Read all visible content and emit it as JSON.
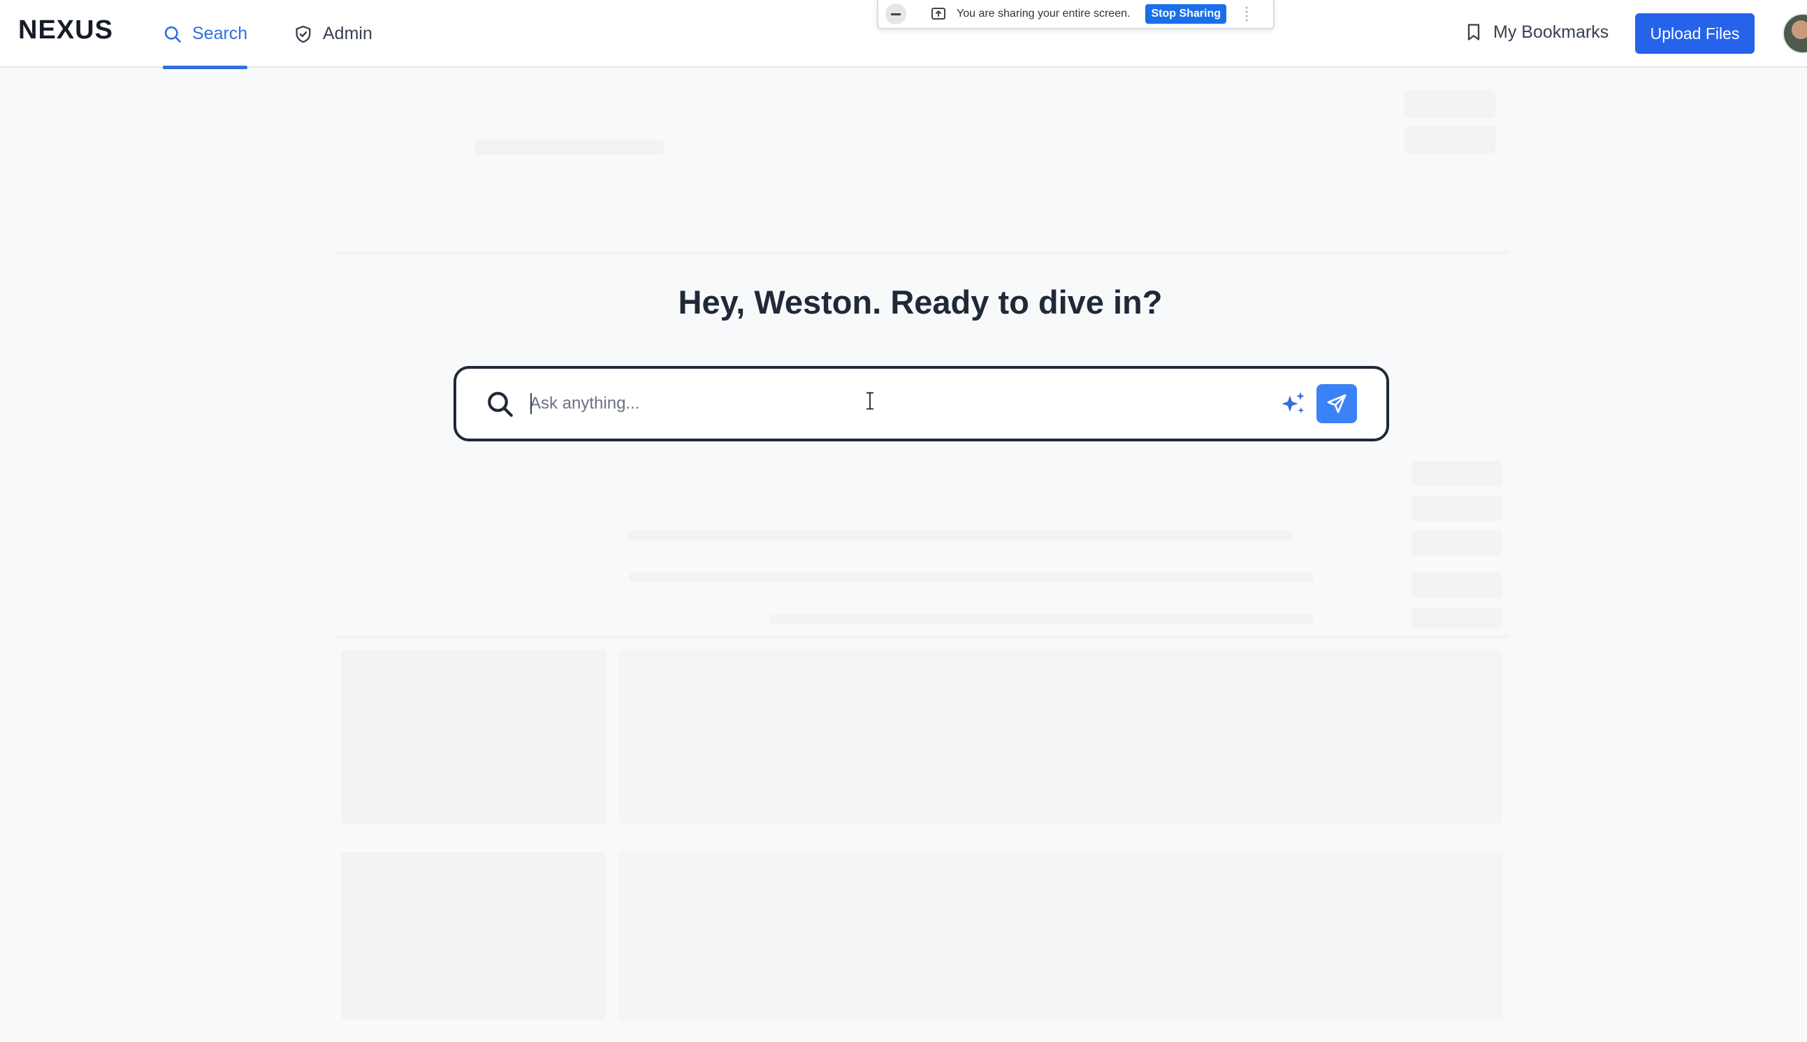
{
  "app": {
    "logo": "NEXUS"
  },
  "nav": {
    "tabs": [
      {
        "label": "Search",
        "icon": "search-icon",
        "active": true
      },
      {
        "label": "Admin",
        "icon": "shield-icon",
        "active": false
      }
    ],
    "bookmarks_label": "My Bookmarks",
    "upload_label": "Upload Files"
  },
  "screen_share": {
    "message": "You are sharing your entire screen.",
    "stop_label": "Stop Sharing"
  },
  "hero": {
    "greeting": "Hey, Weston. Ready to dive in?",
    "search_placeholder": "Ask anything...",
    "search_value": ""
  },
  "colors": {
    "accent": "#2563eb",
    "active_tab": "#2f6fe0",
    "send_button": "#3b82f6",
    "stop_sharing": "#1a6fe8"
  }
}
